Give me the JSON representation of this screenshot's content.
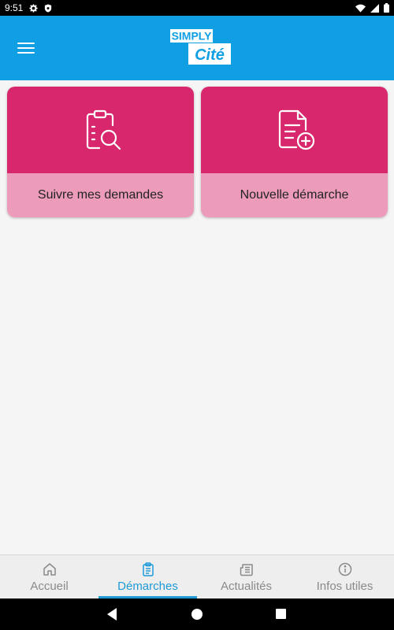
{
  "status_bar": {
    "time": "9:51"
  },
  "app_bar": {
    "logo_top": "SIMPLY",
    "logo_bottom": "Cité"
  },
  "cards": [
    {
      "label": "Suivre mes demandes",
      "icon": "clipboard-search-icon"
    },
    {
      "label": "Nouvelle démarche",
      "icon": "document-add-icon"
    }
  ],
  "bottom_nav": [
    {
      "label": "Accueil",
      "icon": "home-icon",
      "active": false
    },
    {
      "label": "Démarches",
      "icon": "clipboard-icon",
      "active": true
    },
    {
      "label": "Actualités",
      "icon": "newspaper-icon",
      "active": false
    },
    {
      "label": "Infos utiles",
      "icon": "info-icon",
      "active": false
    }
  ],
  "colors": {
    "primary": "#0f9fe2",
    "card_top": "#d8276d",
    "card_bottom": "#ec9cba",
    "nav_active": "#1e9ad8"
  }
}
